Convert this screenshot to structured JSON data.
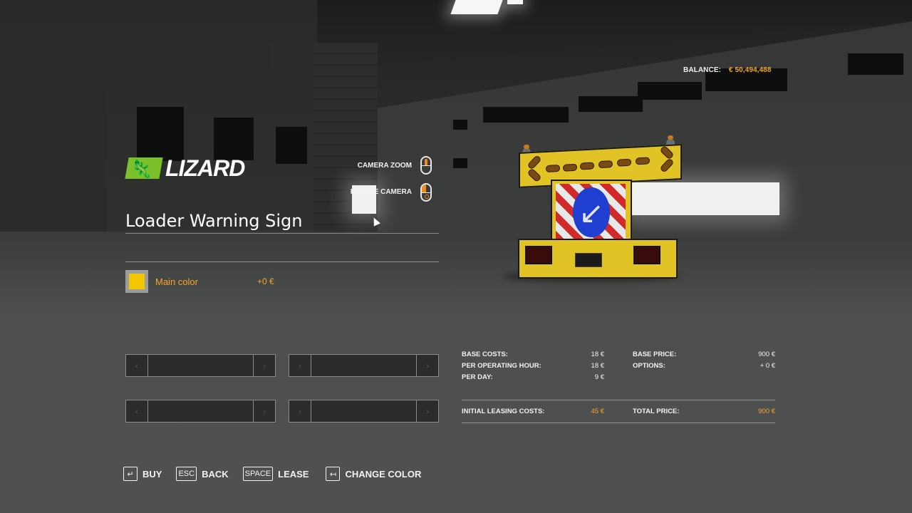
{
  "header": {
    "balance_label": "BALANCE:",
    "balance_value": "€ 50,494,488"
  },
  "brand": {
    "name": "LIZARD",
    "icon": "lizard-logo-icon",
    "badge_color": "#7bbf2a"
  },
  "camera_controls": [
    {
      "label": "CAMERA ZOOM",
      "icon": "mouse-wheel-icon"
    },
    {
      "label": "ROTATE CAMERA",
      "icon": "mouse-left-drag-icon"
    }
  ],
  "vehicle": {
    "title": "Loader Warning Sign"
  },
  "configurations": [
    {
      "label": "Main color",
      "price": "+0 €",
      "swatch_color": "#f2c700"
    }
  ],
  "selectors": [
    {
      "prev": "‹",
      "next": "›",
      "value": ""
    },
    {
      "prev": "‹",
      "next": "›",
      "value": ""
    },
    {
      "prev": "‹",
      "next": "›",
      "value": ""
    },
    {
      "prev": "‹",
      "next": "›",
      "value": ""
    }
  ],
  "costs": {
    "base_costs_label": "BASE COSTS:",
    "base_costs_value": "18 €",
    "per_hour_label": "PER OPERATING HOUR:",
    "per_hour_value": "18 €",
    "per_day_label": "PER DAY:",
    "per_day_value": "9 €",
    "base_price_label": "BASE PRICE:",
    "base_price_value": "900 €",
    "options_label": "OPTIONS:",
    "options_value": "+ 0 €",
    "leasing_label": "INITIAL LEASING COSTS:",
    "leasing_value": "45 €",
    "total_label": "TOTAL PRICE:",
    "total_value": "900 €"
  },
  "actions": [
    {
      "key": "↵",
      "label": "BUY"
    },
    {
      "key": "ESC",
      "label": "BACK"
    },
    {
      "key": "SPACE",
      "label": "LEASE"
    },
    {
      "key": "↤",
      "label": "CHANGE COLOR"
    }
  ],
  "colors": {
    "accent": "#f5a623",
    "text": "#f2f2f2"
  }
}
